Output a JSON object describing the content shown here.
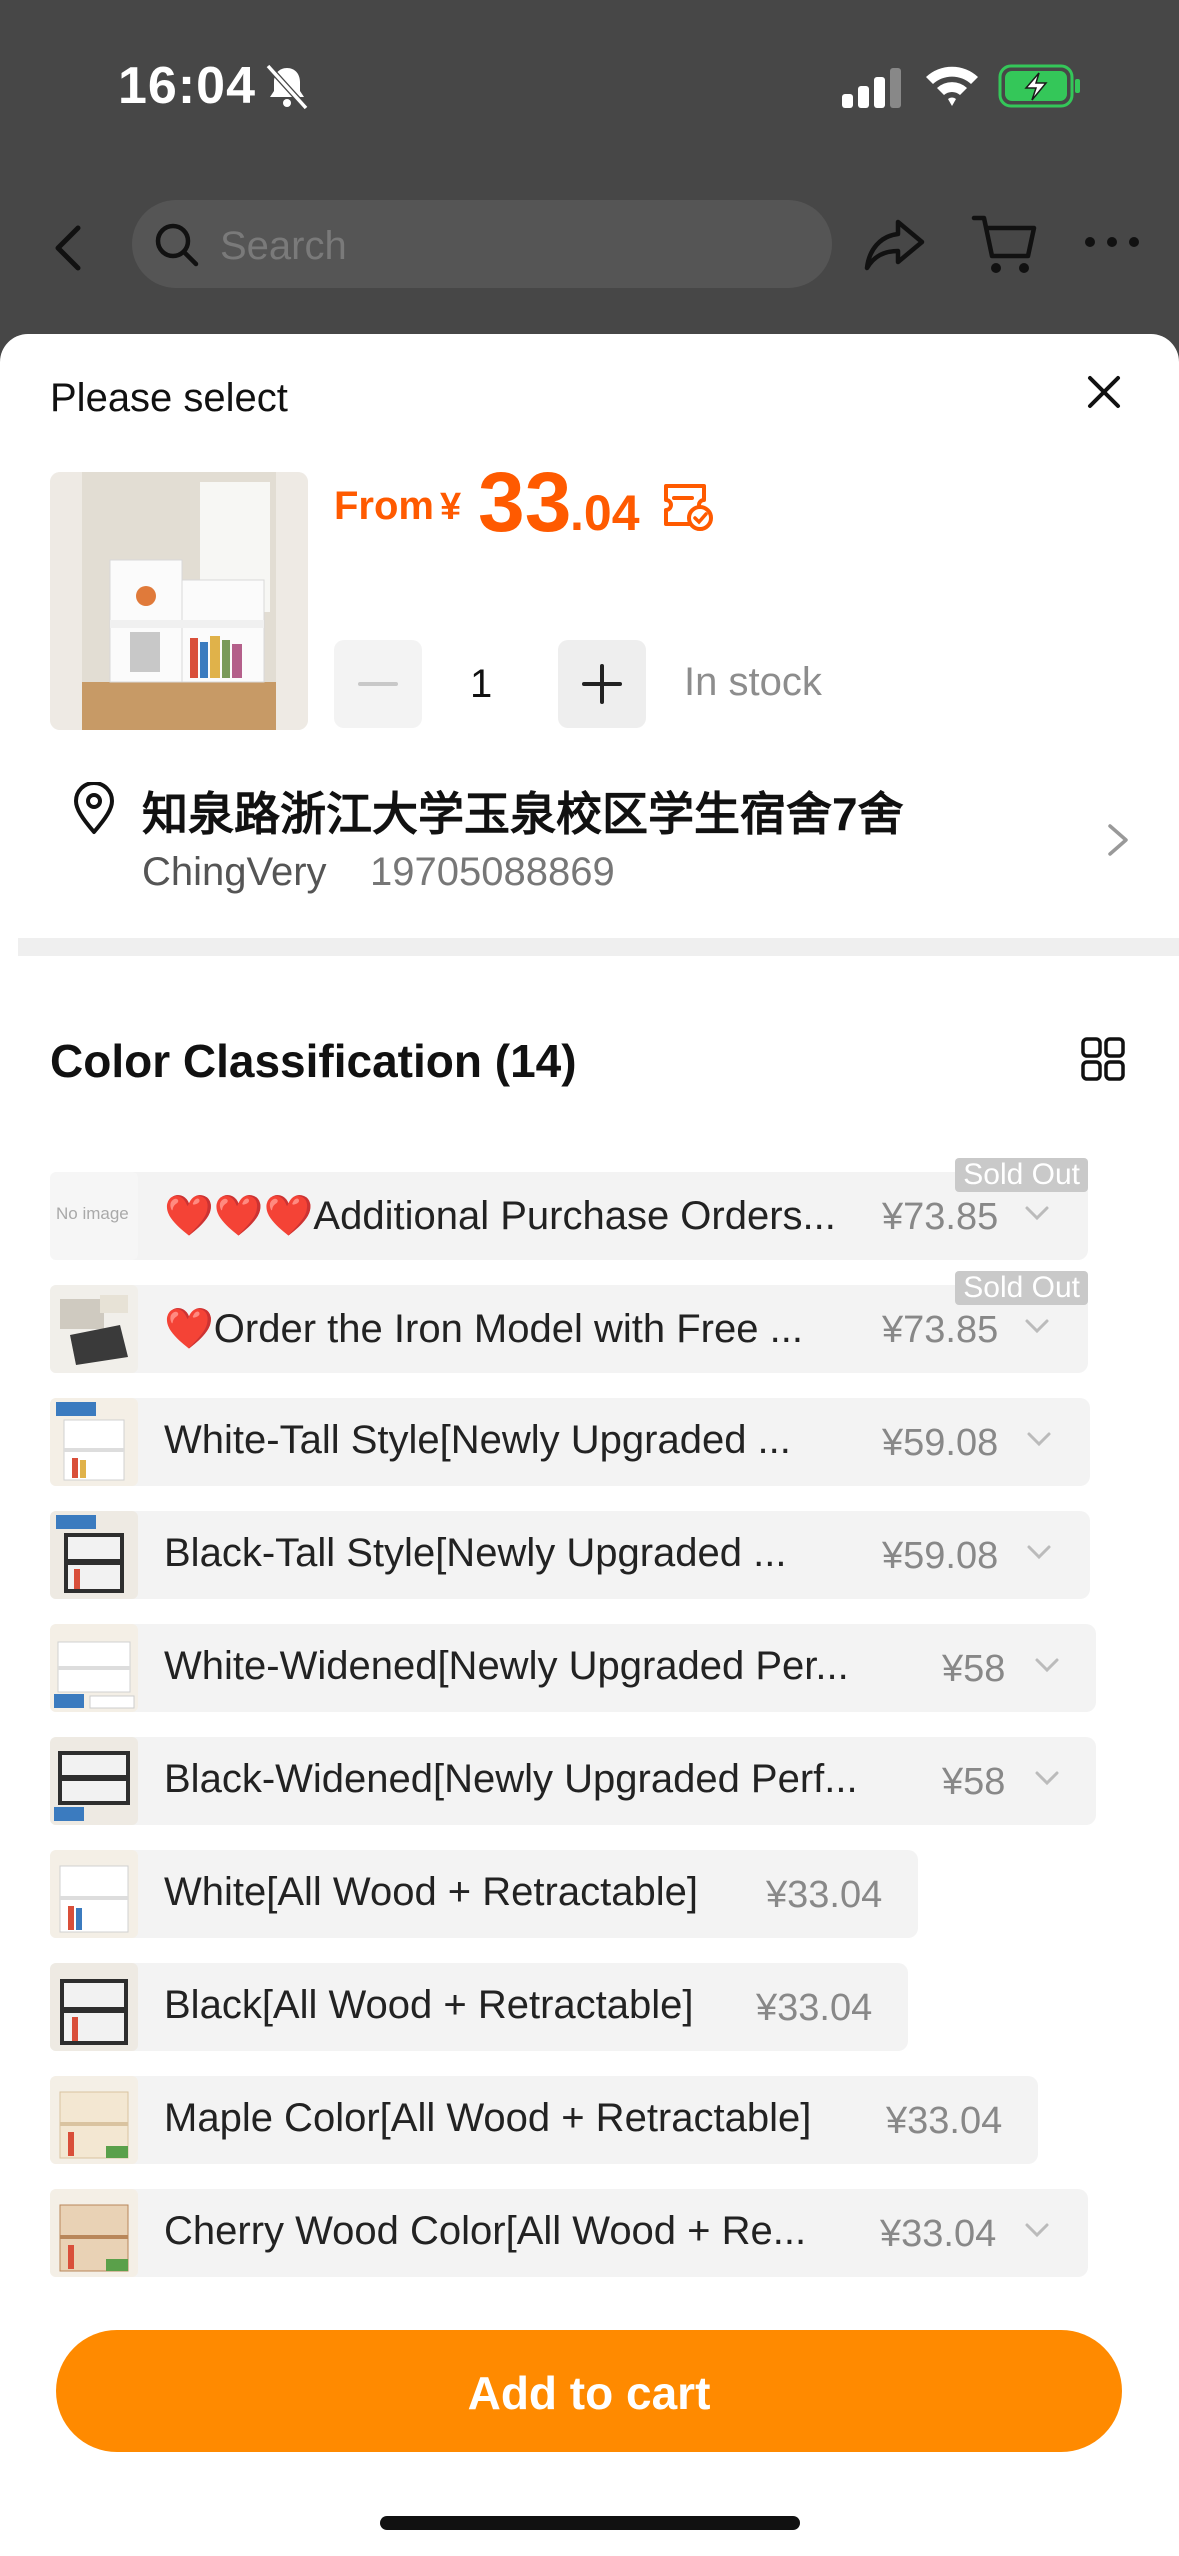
{
  "status_bar": {
    "time": "16:04"
  },
  "nav": {
    "search_placeholder": "Search"
  },
  "sheet": {
    "title": "Please select",
    "price": {
      "prefix": "From",
      "currency": "¥",
      "integer": "33",
      "decimal": ".04"
    },
    "quantity": "1",
    "stock": "In stock",
    "address": {
      "line": "知泉路浙江大学玉泉校区学生宿舍7舍",
      "name": "ChingVery",
      "phone": "19705088869"
    },
    "section_title": "Color Classification (14)",
    "no_image_text": "No image",
    "sold_out_text": "Sold Out",
    "options": [
      {
        "label": "❤️❤️❤️Additional Purchase Orders...",
        "price": "¥73.85",
        "sold_out": true,
        "thumb": "noimage"
      },
      {
        "label": "❤️Order the Iron Model with Free ...",
        "price": "¥73.85",
        "sold_out": true,
        "thumb": "iron"
      },
      {
        "label": "White-Tall Style[Newly Upgraded ...",
        "price": "¥59.08",
        "sold_out": false,
        "thumb": "white"
      },
      {
        "label": "Black-Tall Style[Newly Upgraded ...",
        "price": "¥59.08",
        "sold_out": false,
        "thumb": "black"
      },
      {
        "label": "White-Widened[Newly Upgraded Per...",
        "price": "¥58",
        "sold_out": false,
        "thumb": "white"
      },
      {
        "label": "Black-Widened[Newly Upgraded Perf...",
        "price": "¥58",
        "sold_out": false,
        "thumb": "black"
      },
      {
        "label": "White[All Wood + Retractable]",
        "price": "¥33.04",
        "sold_out": false,
        "thumb": "white"
      },
      {
        "label": "Black[All Wood + Retractable]",
        "price": "¥33.04",
        "sold_out": false,
        "thumb": "black"
      },
      {
        "label": "Maple Color[All Wood + Retractable]",
        "price": "¥33.04",
        "sold_out": false,
        "thumb": "maple"
      },
      {
        "label": "Cherry Wood Color[All Wood + Re...",
        "price": "¥33.04",
        "sold_out": false,
        "thumb": "cherry"
      },
      {
        "label": "",
        "price": "",
        "sold_out": false,
        "thumb": "maple"
      }
    ],
    "add_to_cart": "Add to cart"
  },
  "colors": {
    "accent_orange": "#ff5a00",
    "button_orange": "#ff8a00",
    "battery_green": "#34c759"
  }
}
